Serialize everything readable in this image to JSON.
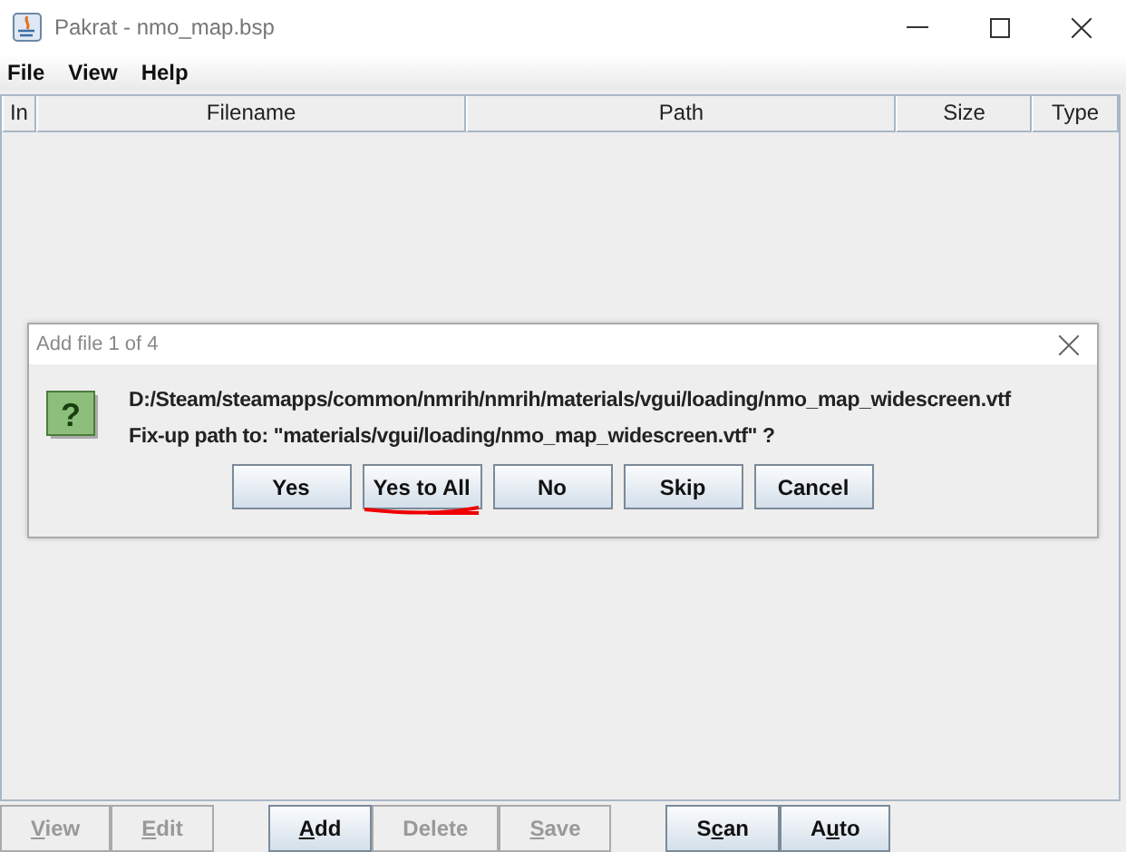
{
  "window": {
    "title": "Pakrat - nmo_map.bsp"
  },
  "menu": [
    "File",
    "View",
    "Help"
  ],
  "table": {
    "columns": [
      "In",
      "Filename",
      "Path",
      "Size",
      "Type"
    ]
  },
  "dialog": {
    "title": "Add file 1 of 4",
    "icon_glyph": "?",
    "lines": [
      "D:/Steam/steamapps/common/nmrih/nmrih/materials/vgui/loading/nmo_map_widescreen.vtf",
      "Fix-up path to: \"materials/vgui/loading/nmo_map_widescreen.vtf\" ?"
    ],
    "buttons": [
      {
        "label": "Yes",
        "marked": false
      },
      {
        "label": "Yes to All",
        "marked": true
      },
      {
        "label": "No",
        "marked": false
      },
      {
        "label": "Skip",
        "marked": false
      },
      {
        "label": "Cancel",
        "marked": false
      }
    ]
  },
  "toolbar": [
    [
      {
        "mnemonic": "V",
        "label_rest": "iew",
        "disabled": true
      },
      {
        "mnemonic": "E",
        "label_rest": "dit",
        "disabled": true
      }
    ],
    [
      {
        "mnemonic": "A",
        "label_rest": "dd",
        "disabled": false
      },
      {
        "label_start": "Delete",
        "disabled": true
      },
      {
        "mnemonic": "S",
        "label_rest": "ave",
        "disabled": true
      }
    ],
    [
      {
        "label_start": "S",
        "mnemonic": "c",
        "label_rest": "an",
        "disabled": false
      },
      {
        "label_start": "A",
        "mnemonic": "u",
        "label_rest": "to",
        "disabled": false
      }
    ]
  ]
}
